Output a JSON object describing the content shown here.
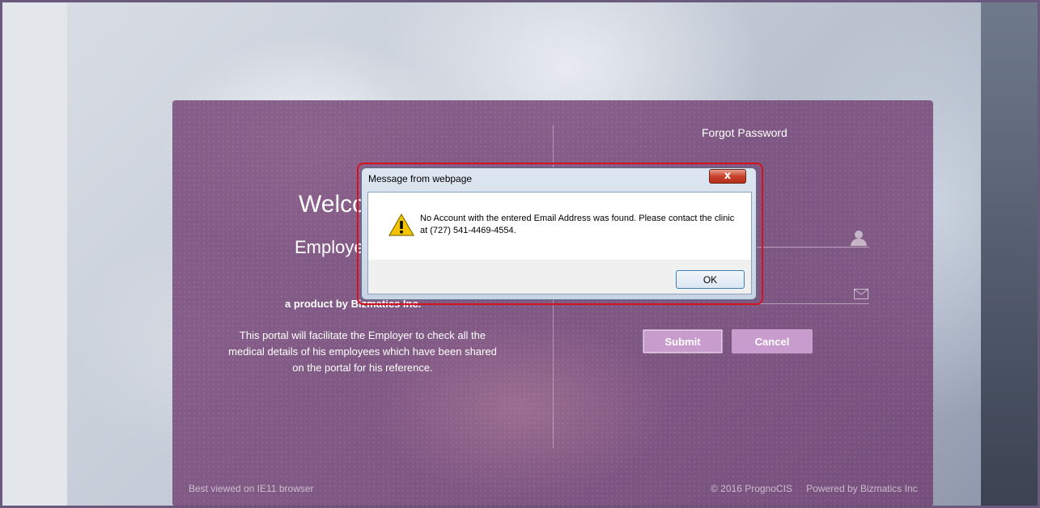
{
  "login_panel": {
    "welcome": "Welco",
    "employer": "Employe",
    "product": "a product by Bizmatics Inc.",
    "description": "This portal will facilitate the Employer to check all the medical details of his employees which have been shared on the portal for his reference."
  },
  "forgot": {
    "title": "Forgot Password",
    "submit_label": "Submit",
    "cancel_label": "Cancel",
    "icons": [
      "user-icon",
      "mail-icon"
    ]
  },
  "footer": {
    "left": "Best viewed on IE11 browser",
    "copyright": "© 2016 PrognoCIS",
    "powered": "Powered by Bizmatics Inc"
  },
  "dialog": {
    "title": "Message from webpage",
    "close_label": "x",
    "message": "No Account with the entered Email Address was found. Please contact the clinic at (727) 541-4469-4554.",
    "ok_label": "OK",
    "icon": "warning-icon",
    "highlight_color": "#d4141c"
  },
  "colors": {
    "panel": "#6e3a6e",
    "button": "#c89ccd"
  }
}
